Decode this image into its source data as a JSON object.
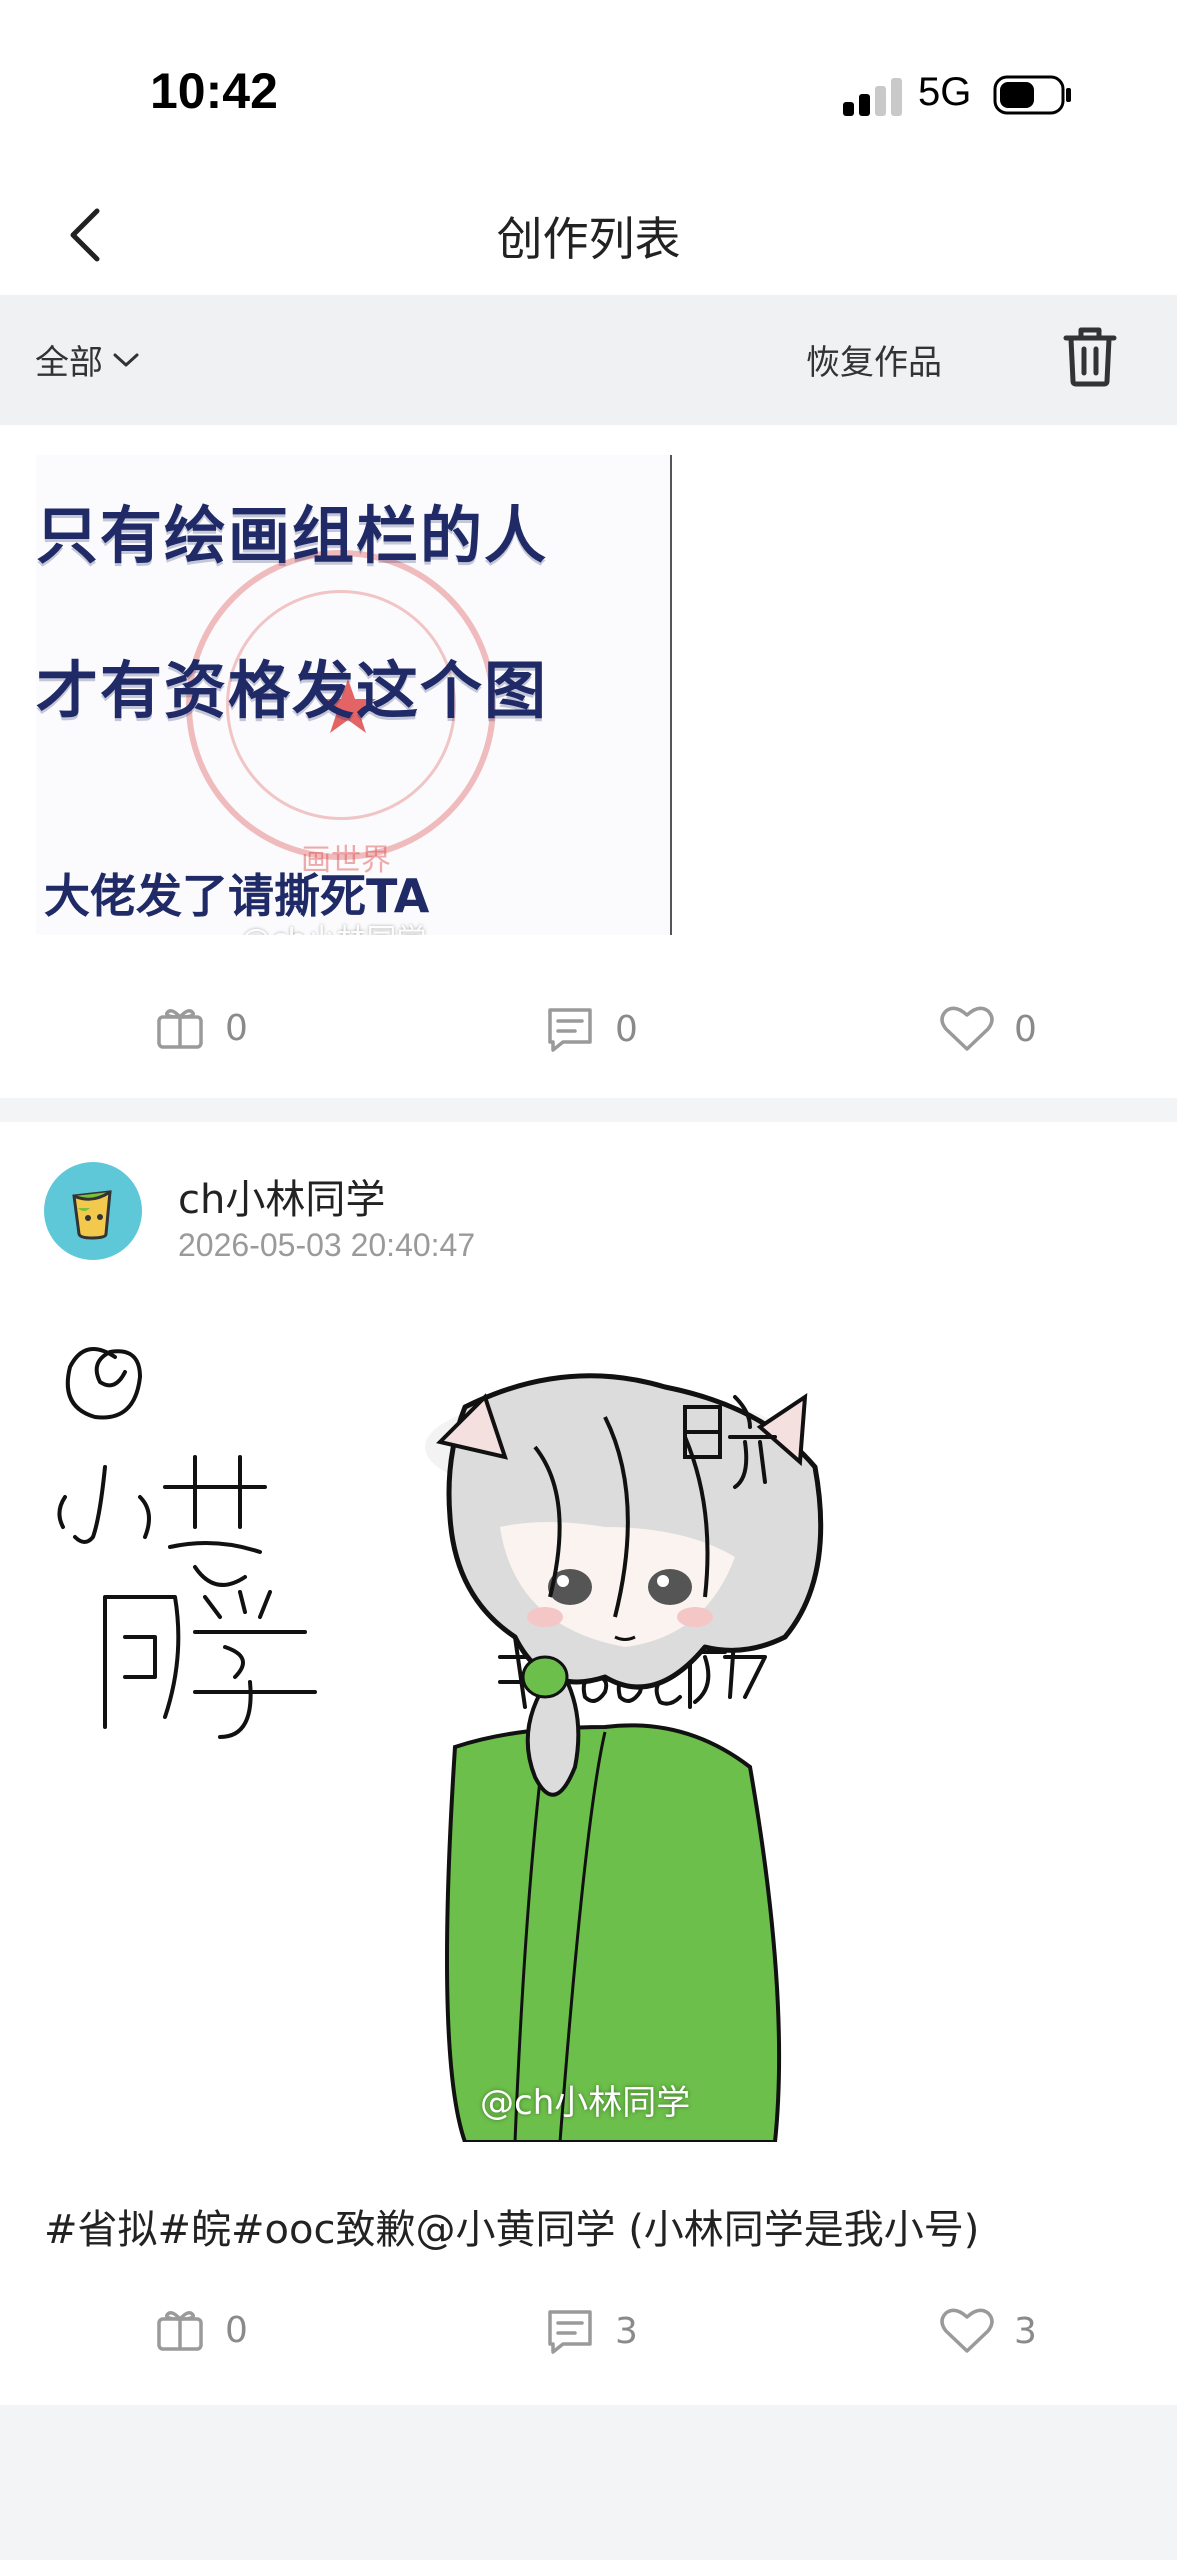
{
  "status_bar": {
    "time": "10:42",
    "network": "5G",
    "battery_level": 0.55
  },
  "header": {
    "title": "创作列表",
    "back_icon": "chevron-left-icon"
  },
  "filter_bar": {
    "filter_label": "全部",
    "restore_label": "恢复作品",
    "delete_icon": "trash-icon"
  },
  "posts": [
    {
      "art": {
        "lines": [
          "只有绘画组栏的人",
          "才有资格发这个图"
        ],
        "small_line": "大佬发了请撕死TA",
        "stamp_text": "画世界",
        "watermark": "@ch小林同学"
      },
      "gifts": "0",
      "comments": "0",
      "likes": "0"
    },
    {
      "author": "ch小林同学",
      "date": "2026-05-03 20:40:47",
      "art": {
        "watermark": "@ch小林同学"
      },
      "caption": "#省拟#皖#ooc致歉@小黄同学 (小林同学是我小号)",
      "gifts": "0",
      "comments": "3",
      "likes": "3"
    }
  ],
  "colors": {
    "accent_blue": "#1f2a66",
    "avatar_bg": "#5fc8d8",
    "jacket_green": "#6cbf4a"
  }
}
